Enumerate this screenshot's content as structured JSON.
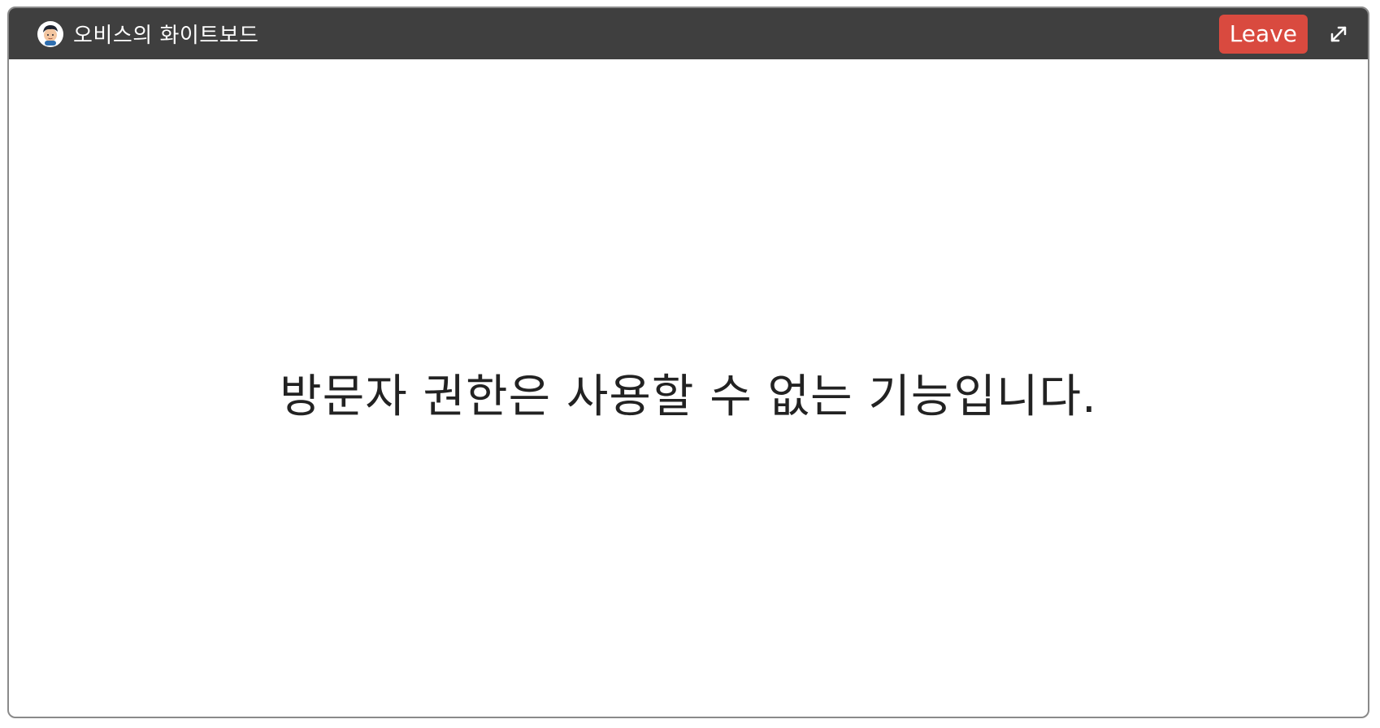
{
  "window": {
    "title": "오비스의 화이트보드",
    "avatar_icon": "user-avatar",
    "leave_label": "Leave",
    "expand_icon": "expand-icon"
  },
  "content": {
    "message": "방문자 권한은 사용할 수 없는 기능입니다."
  },
  "colors": {
    "titlebar": "#3f3f3f",
    "leave_button": "#d94a3f",
    "text": "#222222"
  }
}
